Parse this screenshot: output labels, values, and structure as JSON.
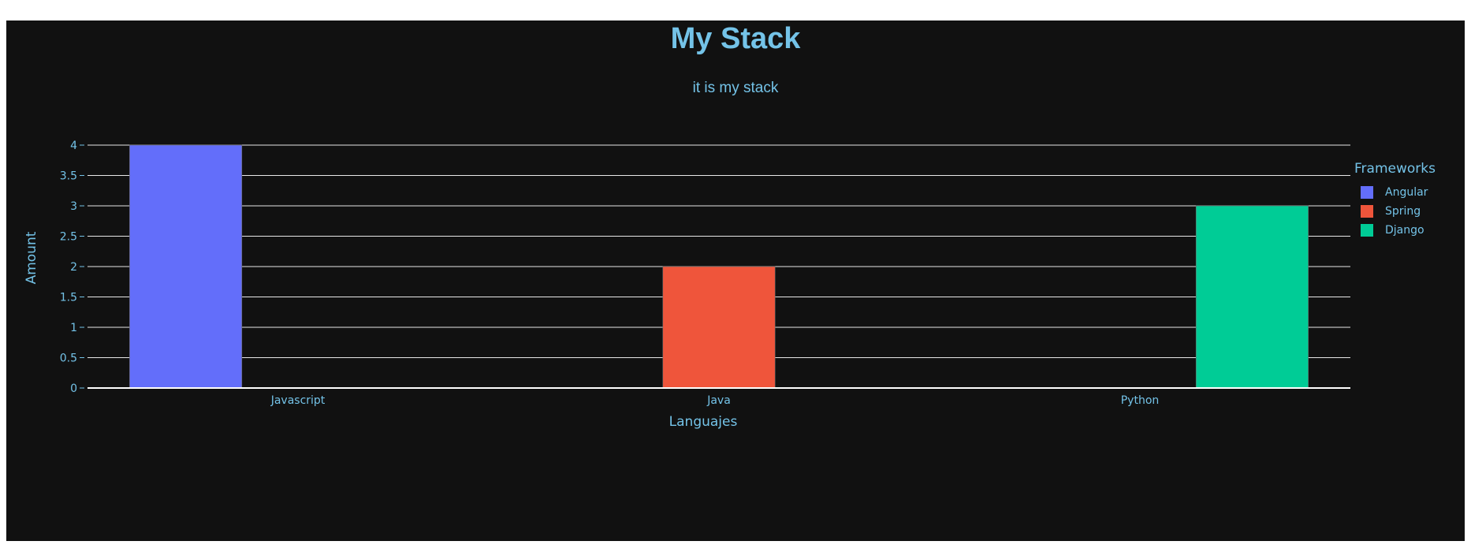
{
  "chart_data": {
    "type": "bar",
    "title": "My Stack",
    "subtitle": "it is my stack",
    "xlabel": "Languajes",
    "ylabel": "Amount",
    "categories": [
      "Javascript",
      "Java",
      "Python"
    ],
    "ylim": [
      0,
      4
    ],
    "yticks": [
      "0",
      "0.5",
      "1",
      "1.5",
      "2",
      "2.5",
      "3",
      "3.5",
      "4"
    ],
    "legend_title": "Frameworks",
    "legend_placement": "right",
    "grid": true,
    "series": [
      {
        "name": "Angular",
        "color": "#636efa",
        "values": [
          4,
          null,
          null
        ]
      },
      {
        "name": "Spring",
        "color": "#ef553b",
        "values": [
          null,
          2,
          null
        ]
      },
      {
        "name": "Django",
        "color": "#00cc96",
        "values": [
          null,
          null,
          3
        ]
      }
    ]
  }
}
